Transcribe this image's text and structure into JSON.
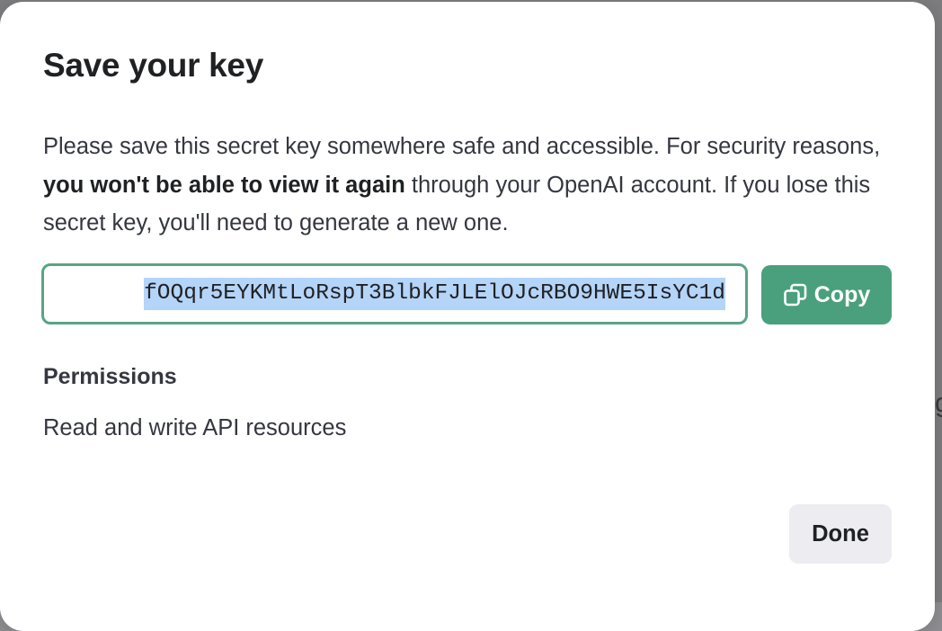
{
  "background": {
    "partial_glyph": "g"
  },
  "dialog": {
    "title": "Save your key",
    "description": {
      "part1": "Please save this secret key somewhere safe and accessible. For security reasons, ",
      "bold": "you won't be able to view it again",
      "part2": " through your OpenAI account. If you lose this secret key, you'll need to generate a new one."
    },
    "key": {
      "value": "fOQqr5EYKMtLoRspT3BlbkFJLElOJcRBO9HWE5IsYC1d",
      "selected": true
    },
    "copy_button": {
      "label": "Copy",
      "icon": "copy-icon"
    },
    "permissions": {
      "title": "Permissions",
      "value": "Read and write API resources"
    },
    "done_button": {
      "label": "Done"
    }
  },
  "colors": {
    "accent": "#4aa07c",
    "focus_border": "#5aa483",
    "selection": "#b4d4f8",
    "secondary_button": "#ececf1",
    "text": "#202123"
  }
}
